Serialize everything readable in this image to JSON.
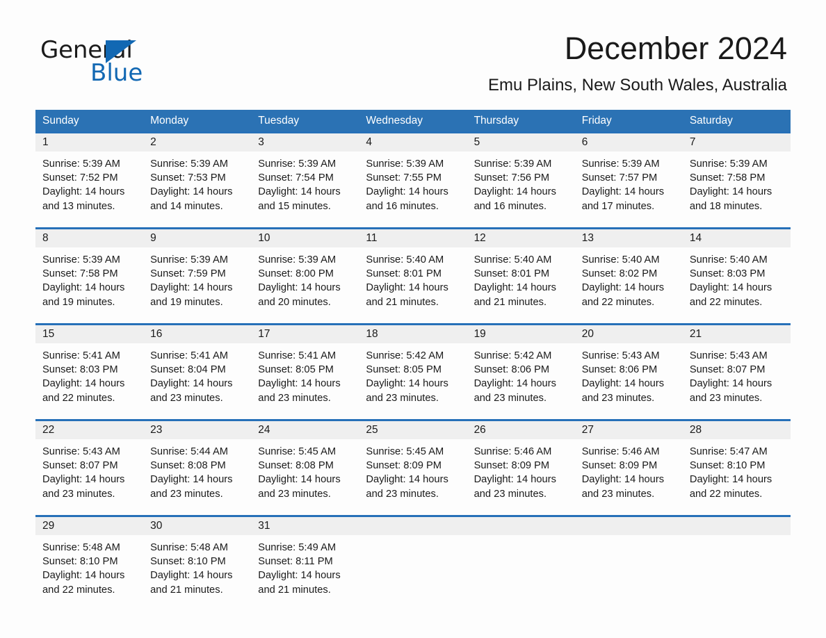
{
  "brand": {
    "word_one": "General",
    "word_two": "Blue",
    "triangle_icon": "triangle-icon",
    "accent_color": "#1268b3"
  },
  "header": {
    "month_title": "December 2024",
    "location": "Emu Plains, New South Wales, Australia"
  },
  "colors": {
    "header_blue": "#2b72b4",
    "row_divider_blue": "#2670b8",
    "date_band_gray": "#efefef",
    "text": "#1a1a1a"
  },
  "weekdays": [
    "Sunday",
    "Monday",
    "Tuesday",
    "Wednesday",
    "Thursday",
    "Friday",
    "Saturday"
  ],
  "weeks": [
    {
      "days": [
        {
          "date": "1",
          "sunrise": "Sunrise: 5:39 AM",
          "sunset": "Sunset: 7:52 PM",
          "daylight": "Daylight: 14 hours and 13 minutes."
        },
        {
          "date": "2",
          "sunrise": "Sunrise: 5:39 AM",
          "sunset": "Sunset: 7:53 PM",
          "daylight": "Daylight: 14 hours and 14 minutes."
        },
        {
          "date": "3",
          "sunrise": "Sunrise: 5:39 AM",
          "sunset": "Sunset: 7:54 PM",
          "daylight": "Daylight: 14 hours and 15 minutes."
        },
        {
          "date": "4",
          "sunrise": "Sunrise: 5:39 AM",
          "sunset": "Sunset: 7:55 PM",
          "daylight": "Daylight: 14 hours and 16 minutes."
        },
        {
          "date": "5",
          "sunrise": "Sunrise: 5:39 AM",
          "sunset": "Sunset: 7:56 PM",
          "daylight": "Daylight: 14 hours and 16 minutes."
        },
        {
          "date": "6",
          "sunrise": "Sunrise: 5:39 AM",
          "sunset": "Sunset: 7:57 PM",
          "daylight": "Daylight: 14 hours and 17 minutes."
        },
        {
          "date": "7",
          "sunrise": "Sunrise: 5:39 AM",
          "sunset": "Sunset: 7:58 PM",
          "daylight": "Daylight: 14 hours and 18 minutes."
        }
      ]
    },
    {
      "days": [
        {
          "date": "8",
          "sunrise": "Sunrise: 5:39 AM",
          "sunset": "Sunset: 7:58 PM",
          "daylight": "Daylight: 14 hours and 19 minutes."
        },
        {
          "date": "9",
          "sunrise": "Sunrise: 5:39 AM",
          "sunset": "Sunset: 7:59 PM",
          "daylight": "Daylight: 14 hours and 19 minutes."
        },
        {
          "date": "10",
          "sunrise": "Sunrise: 5:39 AM",
          "sunset": "Sunset: 8:00 PM",
          "daylight": "Daylight: 14 hours and 20 minutes."
        },
        {
          "date": "11",
          "sunrise": "Sunrise: 5:40 AM",
          "sunset": "Sunset: 8:01 PM",
          "daylight": "Daylight: 14 hours and 21 minutes."
        },
        {
          "date": "12",
          "sunrise": "Sunrise: 5:40 AM",
          "sunset": "Sunset: 8:01 PM",
          "daylight": "Daylight: 14 hours and 21 minutes."
        },
        {
          "date": "13",
          "sunrise": "Sunrise: 5:40 AM",
          "sunset": "Sunset: 8:02 PM",
          "daylight": "Daylight: 14 hours and 22 minutes."
        },
        {
          "date": "14",
          "sunrise": "Sunrise: 5:40 AM",
          "sunset": "Sunset: 8:03 PM",
          "daylight": "Daylight: 14 hours and 22 minutes."
        }
      ]
    },
    {
      "days": [
        {
          "date": "15",
          "sunrise": "Sunrise: 5:41 AM",
          "sunset": "Sunset: 8:03 PM",
          "daylight": "Daylight: 14 hours and 22 minutes."
        },
        {
          "date": "16",
          "sunrise": "Sunrise: 5:41 AM",
          "sunset": "Sunset: 8:04 PM",
          "daylight": "Daylight: 14 hours and 23 minutes."
        },
        {
          "date": "17",
          "sunrise": "Sunrise: 5:41 AM",
          "sunset": "Sunset: 8:05 PM",
          "daylight": "Daylight: 14 hours and 23 minutes."
        },
        {
          "date": "18",
          "sunrise": "Sunrise: 5:42 AM",
          "sunset": "Sunset: 8:05 PM",
          "daylight": "Daylight: 14 hours and 23 minutes."
        },
        {
          "date": "19",
          "sunrise": "Sunrise: 5:42 AM",
          "sunset": "Sunset: 8:06 PM",
          "daylight": "Daylight: 14 hours and 23 minutes."
        },
        {
          "date": "20",
          "sunrise": "Sunrise: 5:43 AM",
          "sunset": "Sunset: 8:06 PM",
          "daylight": "Daylight: 14 hours and 23 minutes."
        },
        {
          "date": "21",
          "sunrise": "Sunrise: 5:43 AM",
          "sunset": "Sunset: 8:07 PM",
          "daylight": "Daylight: 14 hours and 23 minutes."
        }
      ]
    },
    {
      "days": [
        {
          "date": "22",
          "sunrise": "Sunrise: 5:43 AM",
          "sunset": "Sunset: 8:07 PM",
          "daylight": "Daylight: 14 hours and 23 minutes."
        },
        {
          "date": "23",
          "sunrise": "Sunrise: 5:44 AM",
          "sunset": "Sunset: 8:08 PM",
          "daylight": "Daylight: 14 hours and 23 minutes."
        },
        {
          "date": "24",
          "sunrise": "Sunrise: 5:45 AM",
          "sunset": "Sunset: 8:08 PM",
          "daylight": "Daylight: 14 hours and 23 minutes."
        },
        {
          "date": "25",
          "sunrise": "Sunrise: 5:45 AM",
          "sunset": "Sunset: 8:09 PM",
          "daylight": "Daylight: 14 hours and 23 minutes."
        },
        {
          "date": "26",
          "sunrise": "Sunrise: 5:46 AM",
          "sunset": "Sunset: 8:09 PM",
          "daylight": "Daylight: 14 hours and 23 minutes."
        },
        {
          "date": "27",
          "sunrise": "Sunrise: 5:46 AM",
          "sunset": "Sunset: 8:09 PM",
          "daylight": "Daylight: 14 hours and 23 minutes."
        },
        {
          "date": "28",
          "sunrise": "Sunrise: 5:47 AM",
          "sunset": "Sunset: 8:10 PM",
          "daylight": "Daylight: 14 hours and 22 minutes."
        }
      ]
    },
    {
      "days": [
        {
          "date": "29",
          "sunrise": "Sunrise: 5:48 AM",
          "sunset": "Sunset: 8:10 PM",
          "daylight": "Daylight: 14 hours and 22 minutes."
        },
        {
          "date": "30",
          "sunrise": "Sunrise: 5:48 AM",
          "sunset": "Sunset: 8:10 PM",
          "daylight": "Daylight: 14 hours and 21 minutes."
        },
        {
          "date": "31",
          "sunrise": "Sunrise: 5:49 AM",
          "sunset": "Sunset: 8:11 PM",
          "daylight": "Daylight: 14 hours and 21 minutes."
        },
        {
          "date": "",
          "sunrise": "",
          "sunset": "",
          "daylight": ""
        },
        {
          "date": "",
          "sunrise": "",
          "sunset": "",
          "daylight": ""
        },
        {
          "date": "",
          "sunrise": "",
          "sunset": "",
          "daylight": ""
        },
        {
          "date": "",
          "sunrise": "",
          "sunset": "",
          "daylight": ""
        }
      ]
    }
  ]
}
